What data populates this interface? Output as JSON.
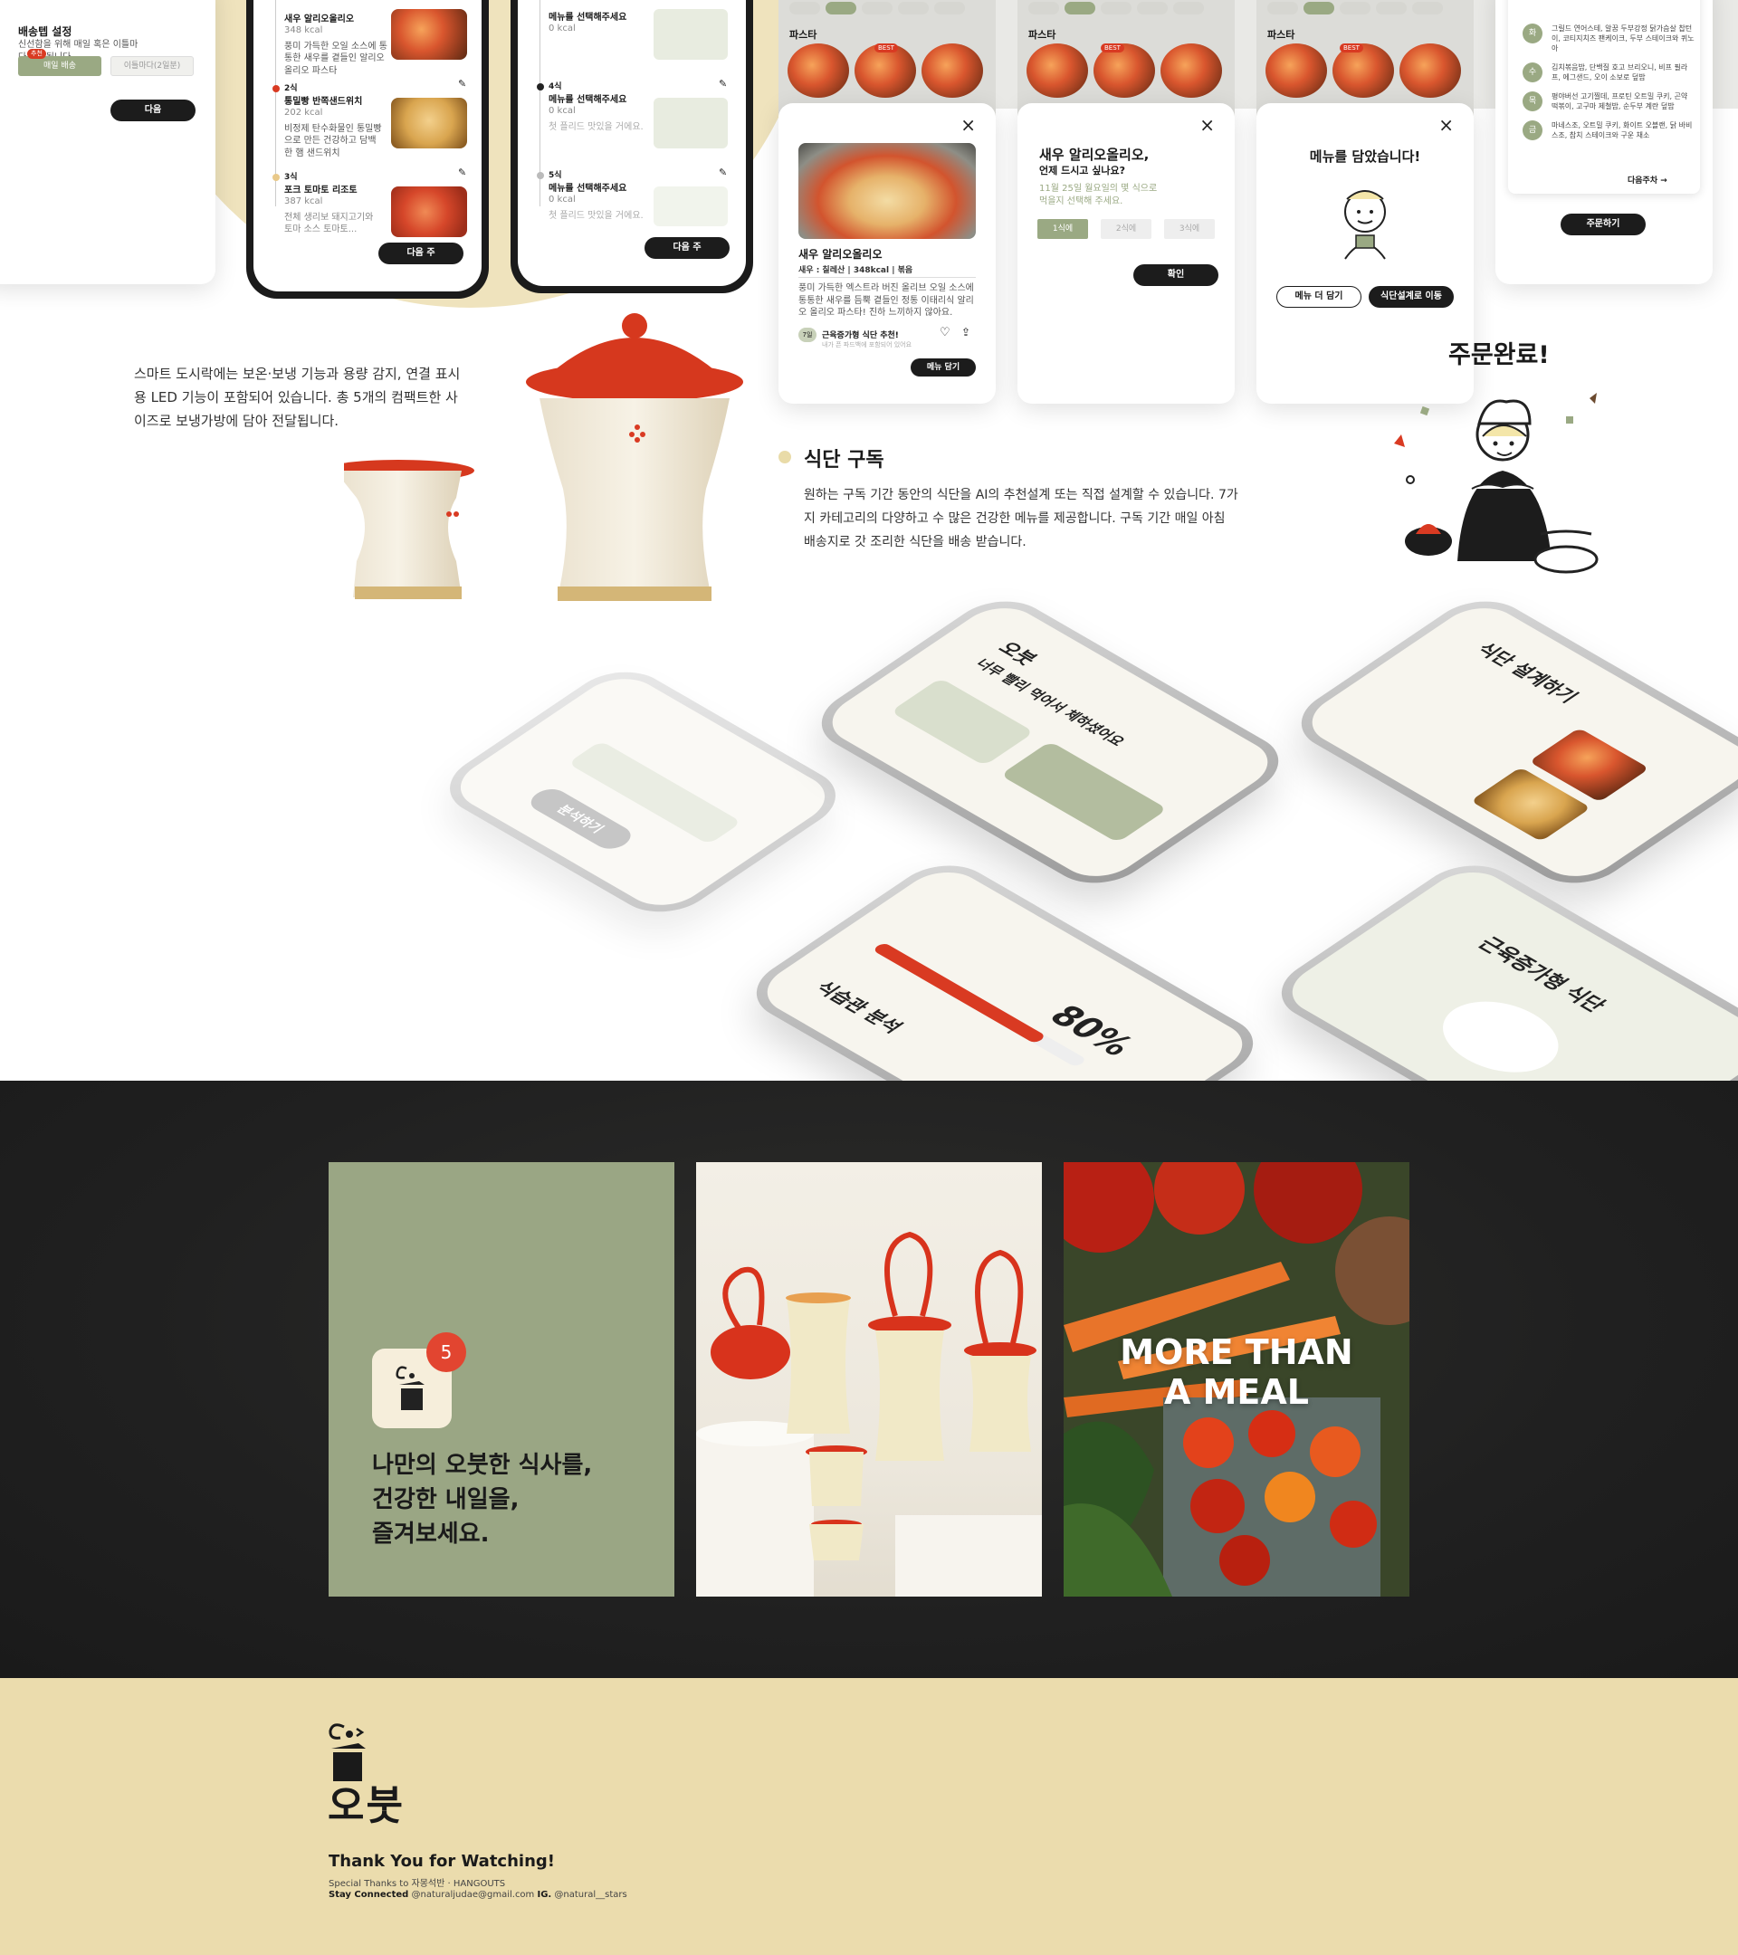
{
  "settings_card": {
    "title": "배송텝 설정",
    "desc": "신선함을 위해 매일 혹은 이틀마다 배송됩니다.",
    "badge": "추천",
    "opt_daily": "매일 배송",
    "opt_every2": "이틀마다(2일분)",
    "next_btn": "다음"
  },
  "phone1": {
    "items": [
      {
        "no": "",
        "name": "새우 알리오올리오",
        "kcal": "348 kcal",
        "desc": "풍미 가득한 오일 소스에 통통한 새우를 곁들인 알리오 올리오 파스타"
      },
      {
        "no": "2식",
        "name": "통밀빵 반쪽샌드위치",
        "kcal": "202 kcal",
        "desc": "비정제 탄수화물인 통밀빵으로 만든 건강하고 담백한 햄 샌드위치"
      },
      {
        "no": "3식",
        "name": "포크 토마토 리조토",
        "kcal": "387 kcal",
        "desc": "전체 생리보 돼지고기와 토마 소스 토마토..."
      }
    ],
    "btn": "다음 주"
  },
  "phone2": {
    "items": [
      {
        "no": "",
        "name": "메뉴를 선택해주세요",
        "kcal": "0 kcal",
        "desc": "첫 플리드 맛있을 거에요."
      },
      {
        "no": "4식",
        "name": "메뉴를 선택해주세요",
        "kcal": "0 kcal",
        "desc": "첫 플리드 맛있을 거에요."
      },
      {
        "no": "5식",
        "name": "메뉴를 선택해주세요",
        "kcal": "0 kcal",
        "desc": "첫 플리드 맛있을 거에요."
      }
    ],
    "btn": "다음 주"
  },
  "modal_pasta": {
    "category": "파스타",
    "best": "BEST",
    "title": "새우 알리오올리오",
    "meta": "새우 : 칠레산 | 348kcal | 볶음",
    "desc": "풍미 가득한 엑스트라 버진 올리브 오일 소스에 통통한 새우를 듬뿍 곁들인 정통 이태리식 알리오 올리오 파스타! 진하 느끼하지 않아요.",
    "tag_badge": "7일",
    "tag": "근육증가형 식단 추천!",
    "tag_sub": "내가 픈 파드백에 포함되어 있어요",
    "btn": "메뉴 담기"
  },
  "modal_time": {
    "category": "파스타",
    "best": "BEST",
    "title": "새우 알리오올리오,",
    "subtitle": "언제 드시고 싶나요?",
    "desc": "11월 25일 월요일의 몇 식으로 먹을지 선택해 주세요.",
    "opts": [
      "1식에",
      "2식에",
      "3식에"
    ],
    "btn": "확인"
  },
  "modal_done": {
    "category": "파스타",
    "best": "BEST",
    "title": "메뉴를 담았습니다!",
    "btn_more": "메뉴 더 담기",
    "btn_go": "식단설계로 이동"
  },
  "list_card": {
    "rows": [
      {
        "day": "화",
        "text": "그릴드 연어스테, 알꿈 두부강정 닭가슴살 찹턴이, 코티지치즈 팬케이크, 두부 스테이크와 퀴노아"
      },
      {
        "day": "수",
        "text": "김치볶음밥, 단백질 호고 브리오니, 비프 필라프, 에그샌드, 오이 소보로 덮밥"
      },
      {
        "day": "목",
        "text": "평야버선 고기찔데, 프로틴 오트밀 쿠키, 곤약 떡볶이, 고구마 제철밥, 순두부 계란 덮밥"
      },
      {
        "day": "금",
        "text": "마네스조, 오트밀 쿠키, 화이트 오블랜, 닭 바비스조, 참치 스테이크와 구운 채소"
      }
    ],
    "next": "다음주차 →",
    "order_btn": "주문하기"
  },
  "order_done": "주문완료!",
  "lunchbox_desc": "스마트 도시락에는 보온·보냉 기능과 용량 감지, 연결 표시용 LED 기능이 포함되어 있습니다. 총 5개의 컴팩트한 사이즈로 보냉가방에 담아 전달됩니다.",
  "subscription": {
    "title": "식단 구독",
    "desc": "원하는 구독 기간 동안의 식단을 AI의 추천설계 또는 직접 설계할 수 있습니다. 7가지 카테고리의 다양하고 수 많은 건강한 메뉴를 제공합니다. 구독 기간 매일 아침 배송지로 갓 조리한 식단을 배송 받습니다."
  },
  "iso_phones": {
    "p1_title": "오붓",
    "p1_sub": "너무 빨리 먹어서 체하셨어요",
    "p2_title": "식단 설계하기",
    "p3_percent": "80",
    "p3_title": "식습관 분석",
    "p4_title": "근육증가형 식단",
    "p5_btn": "분석하기"
  },
  "dark_section": {
    "app_badge": "5",
    "tagline": [
      "나만의 오붓한 식사를,",
      "건강한 내일을,",
      "즐겨보세요."
    ],
    "overlay": [
      "MORE THAN",
      "A MEAL"
    ]
  },
  "footer": {
    "brand": "오붓",
    "thanks": "Thank You for Watching!",
    "special": "Special Thanks to 자몽석반 · HANGOUTS",
    "contact_label": "Stay Connected",
    "email": "@naturaljudae@gmail.com",
    "ig_label": "IG.",
    "ig": "@natural__stars"
  },
  "colors": {
    "accent_sage": "#9aa983",
    "cream": "#efe3bd",
    "footer_bg": "#ebdcad",
    "brand_red": "#d93a22",
    "dark_bg": "#1f1f1f"
  }
}
